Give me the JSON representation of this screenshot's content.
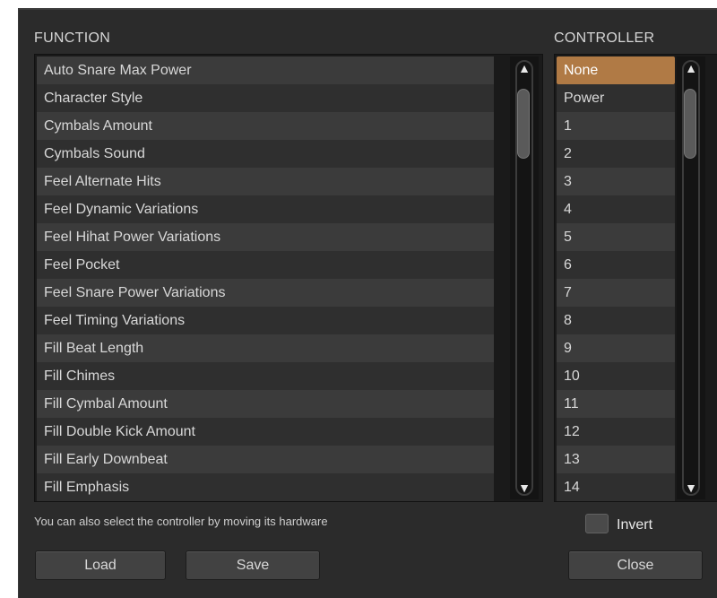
{
  "headers": {
    "function": "FUNCTION",
    "controller": "CONTROLLER"
  },
  "functions": [
    "Auto Snare Max Power",
    "Character Style",
    "Cymbals Amount",
    "Cymbals Sound",
    "Feel Alternate Hits",
    "Feel Dynamic Variations",
    "Feel Hihat Power Variations",
    "Feel Pocket",
    "Feel Snare Power Variations",
    "Feel Timing Variations",
    "Fill Beat Length",
    "Fill Chimes",
    "Fill Cymbal Amount",
    "Fill Double Kick Amount",
    "Fill Early Downbeat",
    "Fill Emphasis"
  ],
  "controllers": [
    "None",
    "Power",
    "1",
    "2",
    "3",
    "4",
    "5",
    "6",
    "7",
    "8",
    "9",
    "10",
    "11",
    "12",
    "13",
    "14"
  ],
  "selected_controller": "None",
  "hint": "You can also select the controller by moving its hardware",
  "invert": {
    "label": "Invert",
    "checked": false
  },
  "buttons": {
    "load": "Load",
    "save": "Save",
    "close": "Close"
  },
  "icons": {
    "scroll_up": "▲",
    "scroll_down": "▼"
  },
  "colors": {
    "selection": "#b07a45",
    "background": "#2b2b2b"
  }
}
